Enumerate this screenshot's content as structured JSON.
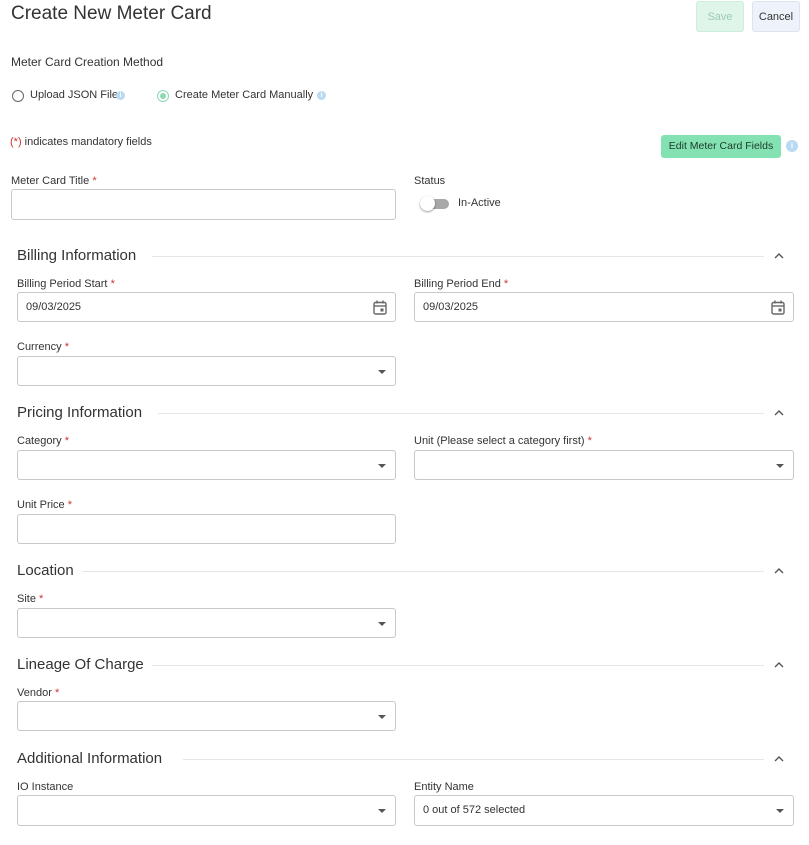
{
  "page": {
    "title": "Create New Meter Card"
  },
  "toolbar": {
    "save_label": "Save",
    "cancel_label": "Cancel"
  },
  "creation_method": {
    "label": "Meter Card Creation Method",
    "options": [
      {
        "label": "Upload JSON File",
        "selected": false
      },
      {
        "label": "Create Meter Card Manually",
        "selected": true
      }
    ]
  },
  "mandatory_note": {
    "marker": "(*)",
    "text": " indicates mandatory fields"
  },
  "edit_fields_button": "Edit Meter Card Fields",
  "meter_card_title": {
    "label": "Meter Card Title",
    "value": ""
  },
  "status": {
    "label": "Status",
    "toggle_text": "In-Active",
    "active": false
  },
  "billing": {
    "heading": "Billing Information",
    "period_start": {
      "label": "Billing Period Start",
      "value": "09/03/2025"
    },
    "period_end": {
      "label": "Billing Period End",
      "value": "09/03/2025"
    },
    "currency": {
      "label": "Currency",
      "value": ""
    }
  },
  "pricing": {
    "heading": "Pricing Information",
    "category": {
      "label": "Category",
      "value": ""
    },
    "unit": {
      "label": "Unit (Please select a category first)",
      "value": ""
    },
    "unit_price": {
      "label": "Unit Price",
      "value": ""
    }
  },
  "location": {
    "heading": "Location",
    "site": {
      "label": "Site",
      "value": ""
    }
  },
  "lineage": {
    "heading": "Lineage Of Charge",
    "vendor": {
      "label": "Vendor",
      "value": ""
    }
  },
  "additional": {
    "heading": "Additional Information",
    "io_instance": {
      "label": "IO Instance",
      "value": ""
    },
    "entity_name": {
      "label": "Entity Name",
      "value": "0 out of 572 selected"
    }
  },
  "required_marker": "*",
  "colors": {
    "accent_green": "#84e2b2",
    "required_red": "#d0332e",
    "info_blue": "#b9daf2"
  },
  "icons": [
    "info-icon",
    "calendar-icon",
    "chevron-down-icon",
    "chevron-up-icon"
  ]
}
